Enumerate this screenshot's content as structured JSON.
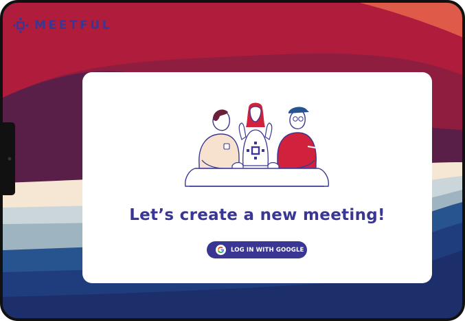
{
  "app": {
    "brand_name": "MEETFUL"
  },
  "main": {
    "headline": "Let’s create a new meeting!",
    "login_button_label": "LOG IN WITH GOOGLE"
  },
  "icons": {
    "brand": "meetful-logo-icon",
    "google": "google-g-icon",
    "illustration": "three-people-at-table-illustration"
  },
  "colors": {
    "brand": "#3a3693",
    "background_top": "#b01c3c",
    "background_deep": "#5a1f48",
    "background_cream": "#f6e6d4",
    "background_blue": "#27538e",
    "card": "#ffffff"
  }
}
